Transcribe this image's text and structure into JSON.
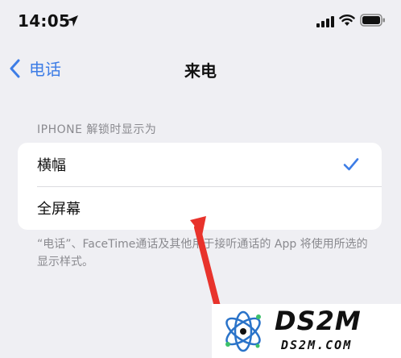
{
  "status_bar": {
    "time": "14:05",
    "icons": [
      "location-arrow-icon",
      "cellular-signal-icon",
      "wifi-icon",
      "battery-icon"
    ]
  },
  "nav": {
    "back_label": "电话",
    "title": "来电"
  },
  "section": {
    "header": "IPHONE 解锁时显示为",
    "options": [
      {
        "label": "横幅",
        "selected": true
      },
      {
        "label": "全屏幕",
        "selected": false
      }
    ],
    "footer": "“电话”、FaceTime通话及其他用于接听通话的 App 将使用所选的显示样式。"
  },
  "watermark": {
    "title": "DS2M",
    "subtitle": "DS2M.COM"
  },
  "colors": {
    "accent": "#3d7de6",
    "background": "#efeff3",
    "annotation_arrow": "#e8332c"
  }
}
